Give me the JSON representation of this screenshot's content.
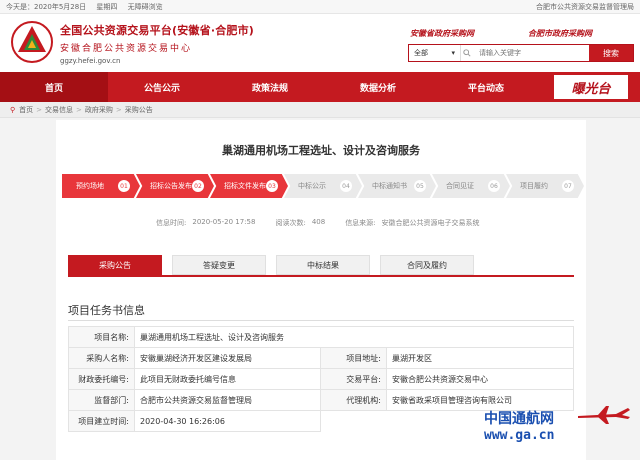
{
  "topbar": {
    "date": "今天是：2020年5月28日",
    "weekday": "星期四",
    "accessibility": "无障碍浏览",
    "right_text": "合肥市公共资源交易监督管理局"
  },
  "header": {
    "title": "全国公共资源交易平台(安徽省·合肥市)",
    "subtitle": "安徽合肥公共资源交易中心",
    "domain": "ggzy.hefei.gov.cn",
    "slogan1": "安徽省政府采购网",
    "slogan2": "合肥市政府采购网"
  },
  "search": {
    "select_value": "全部",
    "placeholder": "请输入关键字",
    "button_label": "搜索"
  },
  "nav": {
    "items": [
      "首页",
      "公告公示",
      "政策法规",
      "数据分析",
      "平台动态"
    ],
    "brand": "曝光台"
  },
  "breadcrumb": [
    "首页",
    "交易信息",
    "政府采购",
    "采购公告"
  ],
  "page": {
    "title": "巢湖通用机场工程选址、设计及咨询服务"
  },
  "steps": [
    {
      "label": "预约场地",
      "num": "01",
      "done": true
    },
    {
      "label": "招标公告发布",
      "num": "02",
      "done": true
    },
    {
      "label": "招标文件发布",
      "num": "03",
      "done": true
    },
    {
      "label": "中标公示",
      "num": "04",
      "done": false
    },
    {
      "label": "中标通知书",
      "num": "05",
      "done": false
    },
    {
      "label": "合同见证",
      "num": "06",
      "done": false
    },
    {
      "label": "项目履约",
      "num": "07",
      "done": false
    }
  ],
  "meta": {
    "time_label": "信息时间:",
    "time_value": "2020-05-20 17:58",
    "views_label": "阅读次数:",
    "views_value": "408",
    "source_label": "信息来源:",
    "source_value": "安徽合肥公共资源电子交易系统"
  },
  "tabs": [
    "采购公告",
    "答疑变更",
    "中标结果",
    "合同及履约"
  ],
  "section": {
    "title": "项目任务书信息",
    "rows": [
      {
        "l1": "项目名称:",
        "v1": "巢湖通用机场工程选址、设计及咨询服务",
        "l2": "",
        "v2": ""
      },
      {
        "l1": "采购人名称:",
        "v1": "安徽巢湖经济开发区建设发展局",
        "l2": "项目地址:",
        "v2": "巢湖开发区"
      },
      {
        "l1": "财政委托编号:",
        "v1": "此项目无财政委托编号信息",
        "l2": "交易平台:",
        "v2": "安徽合肥公共资源交易中心"
      },
      {
        "l1": "监督部门:",
        "v1": "合肥市公共资源交易监督管理局",
        "l2": "代理机构:",
        "v2": "安徽省政采项目管理咨询有限公司"
      },
      {
        "l1": "项目建立时间:",
        "v1": "2020-04-30 16:26:06",
        "l2": "",
        "v2": ""
      }
    ]
  },
  "watermark": {
    "line1": "中国通航网",
    "line2": "www.ga.cn"
  },
  "colors": {
    "brand_red": "#c41a20",
    "step_red": "#e8363b",
    "watermark_blue": "#1a4fb0"
  }
}
